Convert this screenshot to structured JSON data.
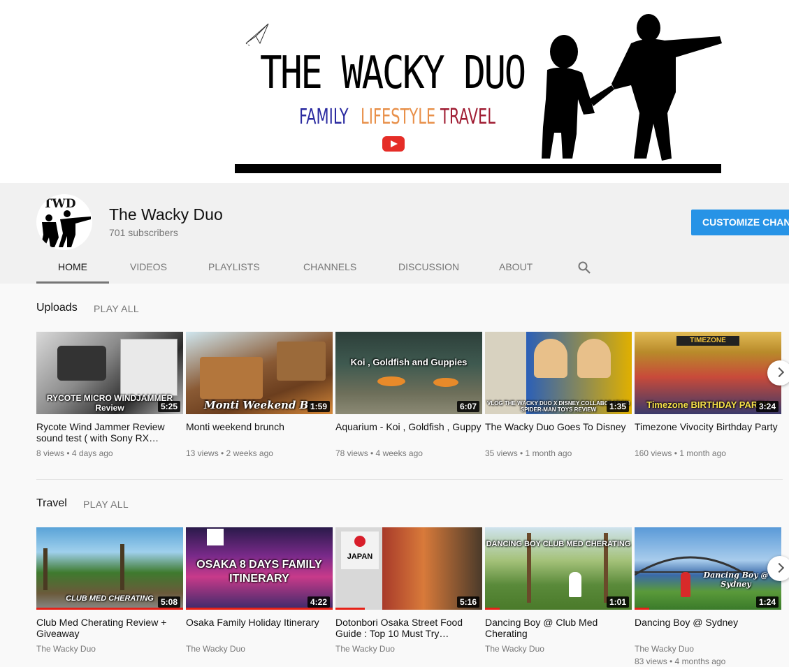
{
  "banner": {
    "title": "THE WACKY DUO",
    "tag_family": "FAMILY",
    "tag_lifestyle": "LIFESTYLE",
    "tag_travel": "TRAVEL"
  },
  "channel": {
    "avatar_text": "TWD",
    "name": "The Wacky Duo",
    "subscribers": "701 subscribers",
    "customize_label": "CUSTOMIZE CHANNEL"
  },
  "tabs": [
    {
      "label": "HOME"
    },
    {
      "label": "VIDEOS"
    },
    {
      "label": "PLAYLISTS"
    },
    {
      "label": "CHANNELS"
    },
    {
      "label": "DISCUSSION"
    },
    {
      "label": "ABOUT"
    }
  ],
  "uploads": {
    "title": "Uploads",
    "play_all": "PLAY ALL",
    "videos": [
      {
        "title": "Rycote Wind Jammer Review sound test ( with Sony RX…",
        "meta": "8 views • 4 days ago",
        "duration": "5:25",
        "caption": "RYCOTE MICRO WINDJAMMER Review",
        "progress": 0.0
      },
      {
        "title": "Monti weekend brunch",
        "meta": "13 views • 2 weeks ago",
        "duration": "1:59",
        "caption": "Monti Weekend Br",
        "progress": 0.0
      },
      {
        "title": "Aquarium - Koi , Goldfish , Guppy",
        "meta": "78 views • 4 weeks ago",
        "duration": "6:07",
        "caption": "Koi , Goldfish and Guppies",
        "progress": 0.0
      },
      {
        "title": "The Wacky Duo Goes To Disney",
        "meta": "35 views • 1 month ago",
        "duration": "1:35",
        "caption": "VLOG THE WACKY DUO X DISNEY COLLABORATION SPIDER-MAN TOYS REVIEW",
        "progress": 0.0
      },
      {
        "title": "Timezone Vivocity Birthday Party",
        "meta": "160 views • 1 month ago",
        "duration": "3:24",
        "caption": "Timezone BIRTHDAY PARTY",
        "progress": 0.0
      }
    ]
  },
  "travel": {
    "title": "Travel",
    "play_all": "PLAY ALL",
    "videos": [
      {
        "title": "Club Med Cherating Review + Giveaway",
        "meta": "The Wacky Duo",
        "meta2": "",
        "duration": "5:08",
        "caption": "CLUB MED CHERATING",
        "progress": 1.0
      },
      {
        "title": "Osaka Family Holiday Itinerary",
        "meta": "The Wacky Duo",
        "meta2": "",
        "duration": "4:22",
        "caption": "OSAKA 8 DAYS FAMILY ITINERARY",
        "progress": 1.0
      },
      {
        "title": "Dotonbori Osaka Street Food Guide : Top 10 Must Try…",
        "meta": "The Wacky Duo",
        "meta2": "",
        "duration": "5:16",
        "caption": "JAPAN",
        "progress": 0.2
      },
      {
        "title": "Dancing Boy @ Club Med Cherating",
        "meta": "The Wacky Duo",
        "meta2": "",
        "duration": "1:01",
        "caption": "DANCING BOY CLUB MED CHERATING",
        "progress": 0.1
      },
      {
        "title": "Dancing Boy @ Sydney",
        "meta": "The Wacky Duo",
        "meta2": "83 views • 4 months ago",
        "duration": "1:24",
        "caption": "Dancing Boy @ Sydney",
        "progress": 0.1
      }
    ]
  }
}
